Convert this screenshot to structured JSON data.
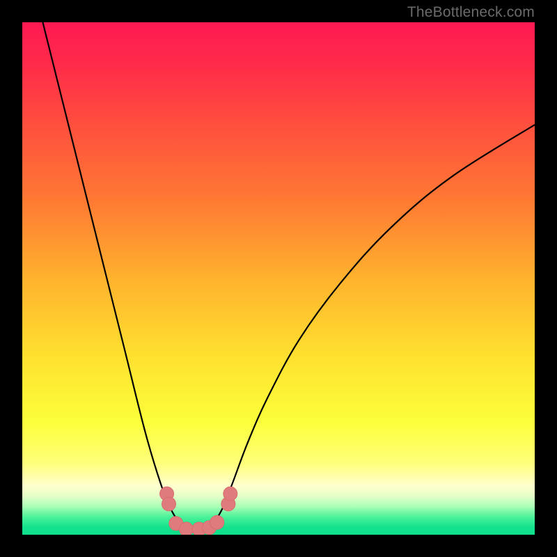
{
  "watermark": {
    "text": "TheBottleneck.com"
  },
  "colors": {
    "frame": "#000000",
    "curve": "#000000",
    "marker_fill": "#e07b7d",
    "marker_stroke": "#d96c6e",
    "gradient": [
      {
        "offset": 0.0,
        "color": "#ff1a52"
      },
      {
        "offset": 0.08,
        "color": "#ff2a4a"
      },
      {
        "offset": 0.2,
        "color": "#ff4f3e"
      },
      {
        "offset": 0.35,
        "color": "#ff7a33"
      },
      {
        "offset": 0.5,
        "color": "#ffb22e"
      },
      {
        "offset": 0.65,
        "color": "#ffe02f"
      },
      {
        "offset": 0.78,
        "color": "#fbff3a"
      },
      {
        "offset": 0.86,
        "color": "#ffff7a"
      },
      {
        "offset": 0.905,
        "color": "#ffffcf"
      },
      {
        "offset": 0.925,
        "color": "#e4ffc8"
      },
      {
        "offset": 0.945,
        "color": "#a9ffb5"
      },
      {
        "offset": 0.965,
        "color": "#4df29a"
      },
      {
        "offset": 0.985,
        "color": "#14e28d"
      },
      {
        "offset": 1.0,
        "color": "#0de08b"
      }
    ]
  },
  "chart_data": {
    "type": "line",
    "title": "",
    "xlabel": "",
    "ylabel": "",
    "xlim": [
      0,
      100
    ],
    "ylim": [
      0,
      100
    ],
    "series": [
      {
        "name": "bottleneck-curve",
        "x": [
          4,
          8,
          12,
          16,
          20,
          24,
          27,
          29,
          31,
          33,
          35,
          37,
          39,
          41,
          44,
          48,
          54,
          62,
          72,
          84,
          100
        ],
        "y": [
          100,
          84,
          68,
          52,
          36,
          20,
          10,
          5,
          2,
          1,
          1,
          2,
          5,
          10,
          18,
          27,
          38,
          49,
          60,
          70,
          80
        ]
      }
    ],
    "markers": {
      "name": "highlight-dots",
      "x": [
        28.2,
        28.6,
        30.0,
        32.0,
        34.5,
        36.5,
        38.0,
        40.2,
        40.6
      ],
      "y": [
        8.0,
        6.0,
        2.2,
        1.1,
        1.1,
        1.4,
        2.4,
        6.0,
        8.0
      ],
      "r": 10
    }
  }
}
